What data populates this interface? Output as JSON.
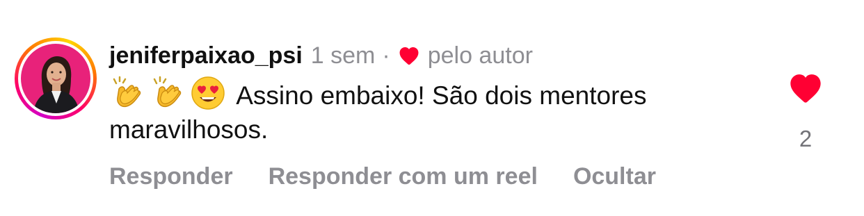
{
  "comment": {
    "username": "jeniferpaixao_psi",
    "time": "1 sem",
    "separator": "·",
    "liked_by_author_label": "pelo autor",
    "text": "Assino embaixo! São dois mentores maravilhosos.",
    "emojis": [
      "clapping-hands",
      "clapping-hands",
      "heart-eyes-face"
    ],
    "like_count": "2",
    "liked": true
  },
  "actions": {
    "reply_label": "Responder",
    "reply_reel_label": "Responder com um reel",
    "hide_label": "Ocultar"
  },
  "colors": {
    "heart": "#ff0033",
    "secondary_text": "#8e8e93",
    "primary_text": "#111111",
    "avatar_bg": "#e8227a"
  }
}
